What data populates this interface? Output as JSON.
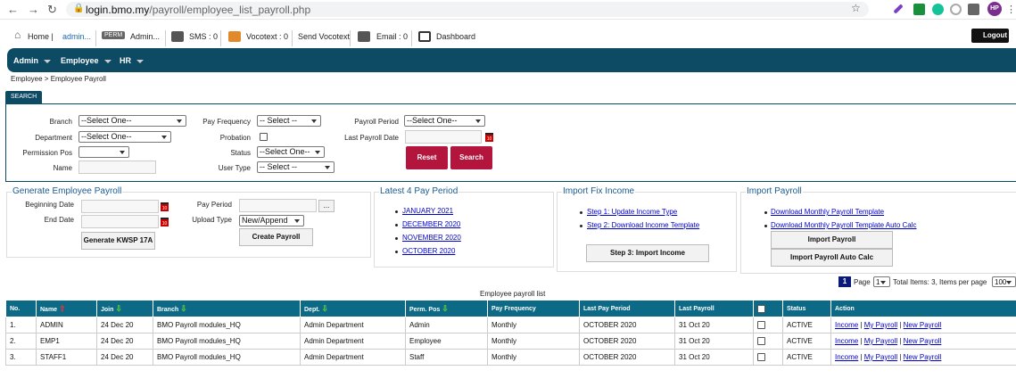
{
  "browser": {
    "host": "login.bmo.my",
    "path": "/payroll/employee_list_payroll.php",
    "profile": "HP"
  },
  "toolbar": {
    "home": "Home |",
    "user": "admin...",
    "perm_badge": "PERM",
    "perm_user": "Admin...",
    "sms": "SMS : 0",
    "vocotext": "Vocotext : 0",
    "send_vocotext": "Send Vocotext",
    "email": "Email : 0",
    "dashboard": "Dashboard",
    "logout": "Logout"
  },
  "menu": {
    "admin": "Admin",
    "employee": "Employee",
    "hr": "HR"
  },
  "breadcrumb": "Employee > Employee Payroll",
  "search": {
    "tab": "SEARCH",
    "branch_label": "Branch",
    "branch_value": "--Select One--",
    "department_label": "Department",
    "department_value": "--Select One--",
    "permission_label": "Permission Pos",
    "permission_value": "",
    "name_label": "Name",
    "pay_freq_label": "Pay Frequency",
    "pay_freq_value": "-- Select --",
    "probation_label": "Probation",
    "status_label": "Status",
    "status_value": "--Select One--",
    "user_type_label": "User Type",
    "user_type_value": "-- Select --",
    "payroll_period_label": "Payroll Period",
    "payroll_period_value": "--Select One--",
    "last_payroll_date_label": "Last Payroll Date",
    "reset": "Reset",
    "search": "Search"
  },
  "generate": {
    "title": "Generate Employee Payroll",
    "beginning_date": "Beginning Date",
    "end_date": "End Date",
    "kwsp": "Generate KWSP 17A",
    "pay_period": "Pay Period",
    "pay_period_btn": "...",
    "upload_type": "Upload Type",
    "upload_value": "New/Append",
    "create": "Create Payroll"
  },
  "latest": {
    "title": "Latest 4 Pay Period",
    "periods": [
      "JANUARY 2021",
      "DECEMBER 2020",
      "NOVEMBER 2020",
      "OCTOBER 2020"
    ]
  },
  "import_fix": {
    "title": "Import Fix Income",
    "step1": "Step 1: Update Income Type",
    "step2": "Step 2: Download Income Template",
    "step3": "Step 3: Import Income"
  },
  "import_payroll": {
    "title": "Import Payroll",
    "link1": "Download Monthly Payroll Template",
    "link2": "Download Monthly Payroll Template Auto Calc",
    "btn1": "Import Payroll",
    "btn2": "Import Payroll Auto Calc"
  },
  "pager": {
    "current": "1",
    "page_label": "Page",
    "page_select": "1",
    "total": "Total Items: 3, Items per page",
    "per_page": "100"
  },
  "table": {
    "caption": "Employee payroll list",
    "headers": [
      "No.",
      "Name",
      "Join",
      "Branch",
      "Dept.",
      "Perm. Pos",
      "Pay Frequency",
      "Last Pay Period",
      "Last Payroll",
      "",
      "Status",
      "Action"
    ],
    "rows": [
      {
        "no": "1.",
        "name": "ADMIN",
        "join": "24 Dec 20",
        "branch": "BMO Payroll modules_HQ",
        "dept": "Admin Department",
        "perm": "Admin",
        "freq": "Monthly",
        "period": "OCTOBER 2020",
        "last": "31 Oct 20",
        "status": "ACTIVE"
      },
      {
        "no": "2.",
        "name": "EMP1",
        "join": "24 Dec 20",
        "branch": "BMO Payroll modules_HQ",
        "dept": "Admin Department",
        "perm": "Employee",
        "freq": "Monthly",
        "period": "OCTOBER 2020",
        "last": "31 Oct 20",
        "status": "ACTIVE"
      },
      {
        "no": "3.",
        "name": "STAFF1",
        "join": "24 Dec 20",
        "branch": "BMO Payroll modules_HQ",
        "dept": "Admin Department",
        "perm": "Staff",
        "freq": "Monthly",
        "period": "OCTOBER 2020",
        "last": "31 Oct 20",
        "status": "ACTIVE"
      }
    ],
    "actions": {
      "income": "Income",
      "sep": " | ",
      "my_payroll": "My Payroll",
      "new_payroll": "New Payroll"
    }
  },
  "colors": {
    "nav": "#0d4a63",
    "header": "#0d6a86",
    "red_button": "#b3153d",
    "link": "#0000cc"
  }
}
